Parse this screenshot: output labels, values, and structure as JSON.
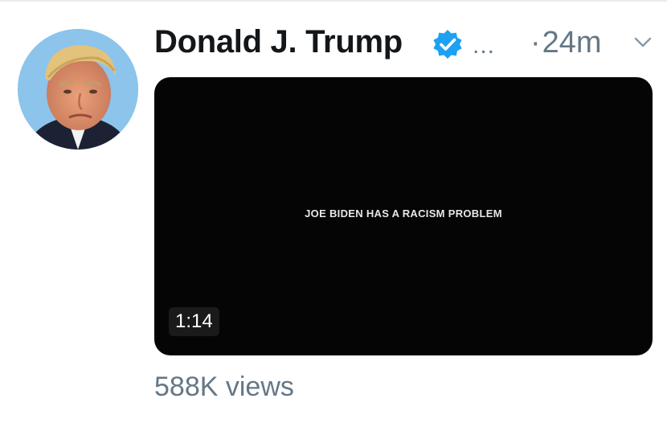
{
  "tweet": {
    "display_name": "Donald J. Trump",
    "ellipsis": "...",
    "dot": "·",
    "timestamp": "24m",
    "video": {
      "caption": "JOE BIDEN HAS A RACISM PROBLEM",
      "duration": "1:14"
    },
    "views": "588K views"
  },
  "icons": {
    "verified": "verified-badge-icon",
    "caret": "chevron-down-icon",
    "avatar": "profile-avatar"
  },
  "colors": {
    "name_text": "#14171a",
    "secondary_text": "#657786",
    "verified_blue": "#1da1f2",
    "video_background": "#050505"
  }
}
